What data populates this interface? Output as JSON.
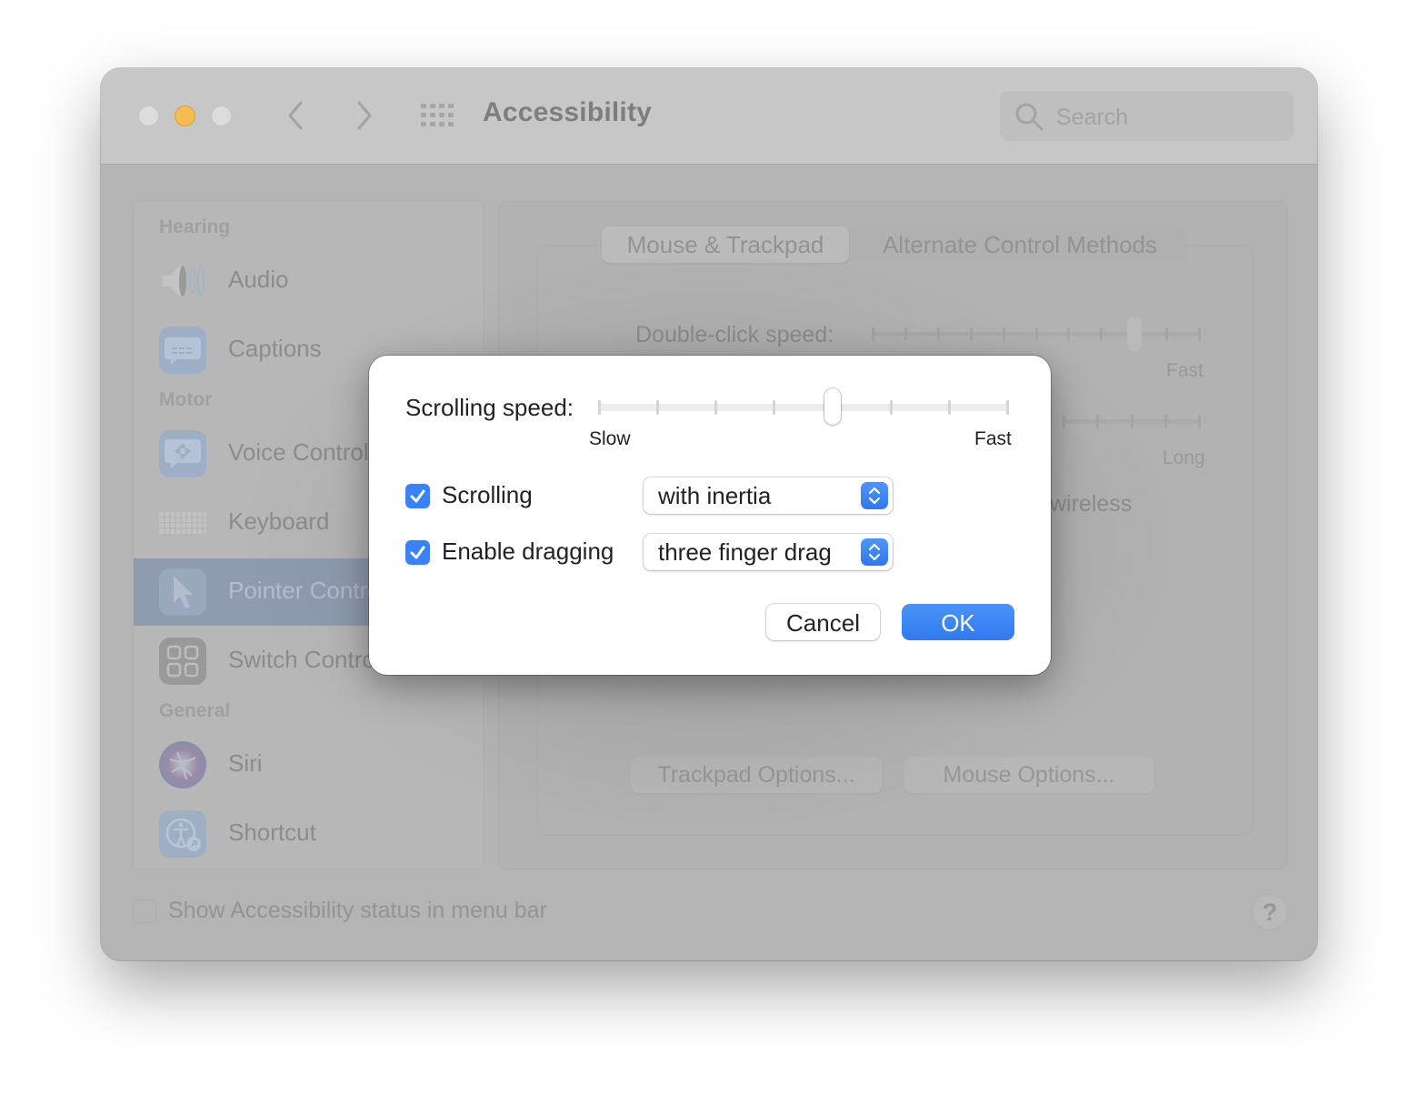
{
  "window": {
    "title": "Accessibility",
    "search": {
      "placeholder": "Search",
      "value": ""
    },
    "traffic_colors": {
      "close": "#dcdcdc",
      "minimize": "#f5bc4f",
      "zoom": "#dcdcdc"
    }
  },
  "sidebar": {
    "sections": [
      {
        "label": "Hearing"
      },
      {
        "label": "Motor"
      },
      {
        "label": "General"
      }
    ],
    "items": [
      {
        "label": "Audio",
        "icon": "speaker-icon",
        "selected": false
      },
      {
        "label": "Captions",
        "icon": "captions-icon",
        "selected": false
      },
      {
        "label": "Voice Control",
        "icon": "voice-control-icon",
        "selected": false
      },
      {
        "label": "Keyboard",
        "icon": "keyboard-icon",
        "selected": false
      },
      {
        "label": "Pointer Control",
        "icon": "pointer-icon",
        "selected": true
      },
      {
        "label": "Switch Control",
        "icon": "switch-control-icon",
        "selected": false
      },
      {
        "label": "Siri",
        "icon": "siri-icon",
        "selected": false
      },
      {
        "label": "Shortcut",
        "icon": "accessibility-shortcut-icon",
        "selected": false
      }
    ]
  },
  "content": {
    "tabs": [
      {
        "label": "Mouse & Trackpad",
        "active": true
      },
      {
        "label": "Alternate Control Methods",
        "active": false
      }
    ],
    "double_click": {
      "label": "Double-click speed:",
      "max_label": "Fast",
      "value_fraction": 0.8,
      "ticks": 11
    },
    "spring_loading": {
      "max_label": "Long"
    },
    "partial_text_wireless": "wireless",
    "trackpad_options_label": "Trackpad Options...",
    "mouse_options_label": "Mouse Options..."
  },
  "footer": {
    "show_status_label": "Show Accessibility status in menu bar",
    "show_status_checked": false,
    "help_label": "?"
  },
  "dialog": {
    "scrolling_speed": {
      "label": "Scrolling speed:",
      "min_label": "Slow",
      "max_label": "Fast",
      "value_fraction": 0.571,
      "ticks": 8
    },
    "scrolling": {
      "label": "Scrolling",
      "checked": true,
      "option": "with inertia"
    },
    "dragging": {
      "label": "Enable dragging",
      "checked": true,
      "option": "three finger drag"
    },
    "cancel_label": "Cancel",
    "ok_label": "OK",
    "accent_color": "#3a82f7"
  }
}
